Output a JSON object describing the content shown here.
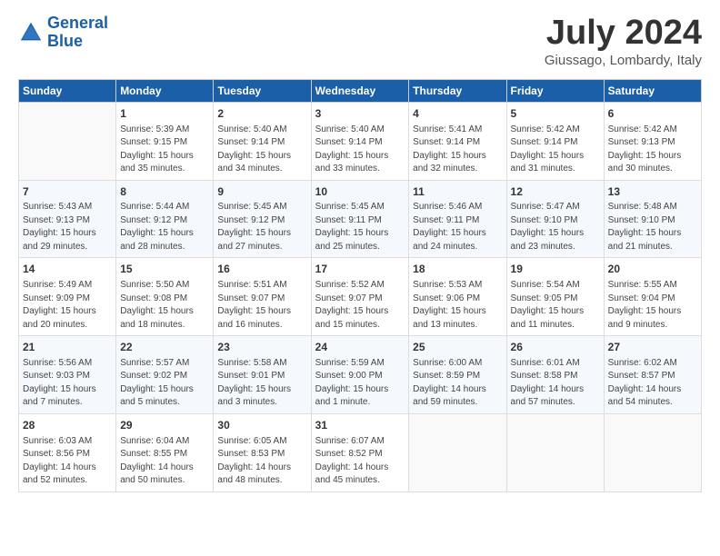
{
  "header": {
    "logo_line1": "General",
    "logo_line2": "Blue",
    "month_title": "July 2024",
    "location": "Giussago, Lombardy, Italy"
  },
  "days_of_week": [
    "Sunday",
    "Monday",
    "Tuesday",
    "Wednesday",
    "Thursday",
    "Friday",
    "Saturday"
  ],
  "weeks": [
    [
      {
        "num": "",
        "info": ""
      },
      {
        "num": "1",
        "info": "Sunrise: 5:39 AM\nSunset: 9:15 PM\nDaylight: 15 hours\nand 35 minutes."
      },
      {
        "num": "2",
        "info": "Sunrise: 5:40 AM\nSunset: 9:14 PM\nDaylight: 15 hours\nand 34 minutes."
      },
      {
        "num": "3",
        "info": "Sunrise: 5:40 AM\nSunset: 9:14 PM\nDaylight: 15 hours\nand 33 minutes."
      },
      {
        "num": "4",
        "info": "Sunrise: 5:41 AM\nSunset: 9:14 PM\nDaylight: 15 hours\nand 32 minutes."
      },
      {
        "num": "5",
        "info": "Sunrise: 5:42 AM\nSunset: 9:14 PM\nDaylight: 15 hours\nand 31 minutes."
      },
      {
        "num": "6",
        "info": "Sunrise: 5:42 AM\nSunset: 9:13 PM\nDaylight: 15 hours\nand 30 minutes."
      }
    ],
    [
      {
        "num": "7",
        "info": "Sunrise: 5:43 AM\nSunset: 9:13 PM\nDaylight: 15 hours\nand 29 minutes."
      },
      {
        "num": "8",
        "info": "Sunrise: 5:44 AM\nSunset: 9:12 PM\nDaylight: 15 hours\nand 28 minutes."
      },
      {
        "num": "9",
        "info": "Sunrise: 5:45 AM\nSunset: 9:12 PM\nDaylight: 15 hours\nand 27 minutes."
      },
      {
        "num": "10",
        "info": "Sunrise: 5:45 AM\nSunset: 9:11 PM\nDaylight: 15 hours\nand 25 minutes."
      },
      {
        "num": "11",
        "info": "Sunrise: 5:46 AM\nSunset: 9:11 PM\nDaylight: 15 hours\nand 24 minutes."
      },
      {
        "num": "12",
        "info": "Sunrise: 5:47 AM\nSunset: 9:10 PM\nDaylight: 15 hours\nand 23 minutes."
      },
      {
        "num": "13",
        "info": "Sunrise: 5:48 AM\nSunset: 9:10 PM\nDaylight: 15 hours\nand 21 minutes."
      }
    ],
    [
      {
        "num": "14",
        "info": "Sunrise: 5:49 AM\nSunset: 9:09 PM\nDaylight: 15 hours\nand 20 minutes."
      },
      {
        "num": "15",
        "info": "Sunrise: 5:50 AM\nSunset: 9:08 PM\nDaylight: 15 hours\nand 18 minutes."
      },
      {
        "num": "16",
        "info": "Sunrise: 5:51 AM\nSunset: 9:07 PM\nDaylight: 15 hours\nand 16 minutes."
      },
      {
        "num": "17",
        "info": "Sunrise: 5:52 AM\nSunset: 9:07 PM\nDaylight: 15 hours\nand 15 minutes."
      },
      {
        "num": "18",
        "info": "Sunrise: 5:53 AM\nSunset: 9:06 PM\nDaylight: 15 hours\nand 13 minutes."
      },
      {
        "num": "19",
        "info": "Sunrise: 5:54 AM\nSunset: 9:05 PM\nDaylight: 15 hours\nand 11 minutes."
      },
      {
        "num": "20",
        "info": "Sunrise: 5:55 AM\nSunset: 9:04 PM\nDaylight: 15 hours\nand 9 minutes."
      }
    ],
    [
      {
        "num": "21",
        "info": "Sunrise: 5:56 AM\nSunset: 9:03 PM\nDaylight: 15 hours\nand 7 minutes."
      },
      {
        "num": "22",
        "info": "Sunrise: 5:57 AM\nSunset: 9:02 PM\nDaylight: 15 hours\nand 5 minutes."
      },
      {
        "num": "23",
        "info": "Sunrise: 5:58 AM\nSunset: 9:01 PM\nDaylight: 15 hours\nand 3 minutes."
      },
      {
        "num": "24",
        "info": "Sunrise: 5:59 AM\nSunset: 9:00 PM\nDaylight: 15 hours\nand 1 minute."
      },
      {
        "num": "25",
        "info": "Sunrise: 6:00 AM\nSunset: 8:59 PM\nDaylight: 14 hours\nand 59 minutes."
      },
      {
        "num": "26",
        "info": "Sunrise: 6:01 AM\nSunset: 8:58 PM\nDaylight: 14 hours\nand 57 minutes."
      },
      {
        "num": "27",
        "info": "Sunrise: 6:02 AM\nSunset: 8:57 PM\nDaylight: 14 hours\nand 54 minutes."
      }
    ],
    [
      {
        "num": "28",
        "info": "Sunrise: 6:03 AM\nSunset: 8:56 PM\nDaylight: 14 hours\nand 52 minutes."
      },
      {
        "num": "29",
        "info": "Sunrise: 6:04 AM\nSunset: 8:55 PM\nDaylight: 14 hours\nand 50 minutes."
      },
      {
        "num": "30",
        "info": "Sunrise: 6:05 AM\nSunset: 8:53 PM\nDaylight: 14 hours\nand 48 minutes."
      },
      {
        "num": "31",
        "info": "Sunrise: 6:07 AM\nSunset: 8:52 PM\nDaylight: 14 hours\nand 45 minutes."
      },
      {
        "num": "",
        "info": ""
      },
      {
        "num": "",
        "info": ""
      },
      {
        "num": "",
        "info": ""
      }
    ]
  ]
}
